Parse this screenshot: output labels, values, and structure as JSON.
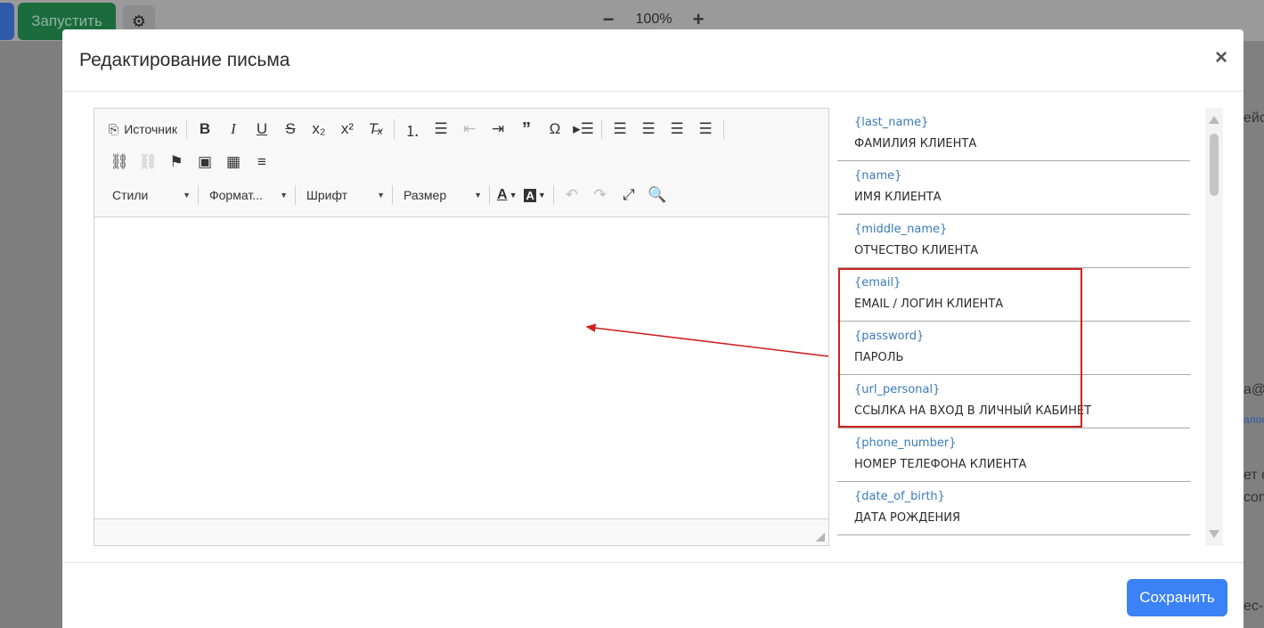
{
  "background": {
    "run_button_label": "Запустить",
    "zoom_level": "100%",
    "right_clipped_texts": [
      "ейст",
      "a@y",
      "алон",
      "ет о",
      "com",
      "ес-п"
    ]
  },
  "modal": {
    "title": "Редактирование письма",
    "close_glyph": "×",
    "save_label": "Сохранить"
  },
  "editor": {
    "source_label": "Источник",
    "combos": {
      "styles": "Стили",
      "format": "Формат...",
      "font": "Шрифт",
      "size": "Размер"
    }
  },
  "variables": [
    {
      "key": "{last_name}",
      "desc": "ФАМИЛИЯ КЛИЕНТА"
    },
    {
      "key": "{name}",
      "desc": "ИМЯ КЛИЕНТА"
    },
    {
      "key": "{middle_name}",
      "desc": "ОТЧЕСТВО КЛИЕНТА"
    },
    {
      "key": "{email}",
      "desc": "EMAIL / ЛОГИН КЛИЕНТА"
    },
    {
      "key": "{password}",
      "desc": "ПАРОЛЬ"
    },
    {
      "key": "{url_personal}",
      "desc": "ССЫЛКА НА ВХОД В ЛИЧНЫЙ КАБИНЕТ"
    },
    {
      "key": "{phone_number}",
      "desc": "НОМЕР ТЕЛЕФОНА КЛИЕНТА"
    },
    {
      "key": "{date_of_birth}",
      "desc": "ДАТА РОЖДЕНИЯ"
    }
  ],
  "colors": {
    "accent": "#3b82f6",
    "variable_key": "#3a7ab8",
    "highlight": "#d0211f",
    "run_button": "#1b6b3d"
  },
  "icons": {
    "toolbar_row1": [
      "source-icon",
      "bold-icon",
      "italic-icon",
      "underline-icon",
      "strikethrough-icon",
      "subscript-icon",
      "superscript-icon",
      "remove-format-icon",
      "numbered-list-icon",
      "bulleted-list-icon",
      "outdent-icon",
      "indent-icon",
      "blockquote-icon",
      "special-char-icon",
      "div-container-icon",
      "align-left-icon",
      "align-center-icon",
      "align-right-icon",
      "align-justify-icon"
    ],
    "toolbar_row2": [
      "link-icon",
      "unlink-icon",
      "anchor-icon",
      "image-icon",
      "table-icon",
      "horizontal-rule-icon"
    ],
    "toolbar_row3": [
      "text-color-icon",
      "background-color-icon",
      "undo-icon",
      "redo-icon",
      "maximize-icon",
      "preview-icon"
    ]
  }
}
